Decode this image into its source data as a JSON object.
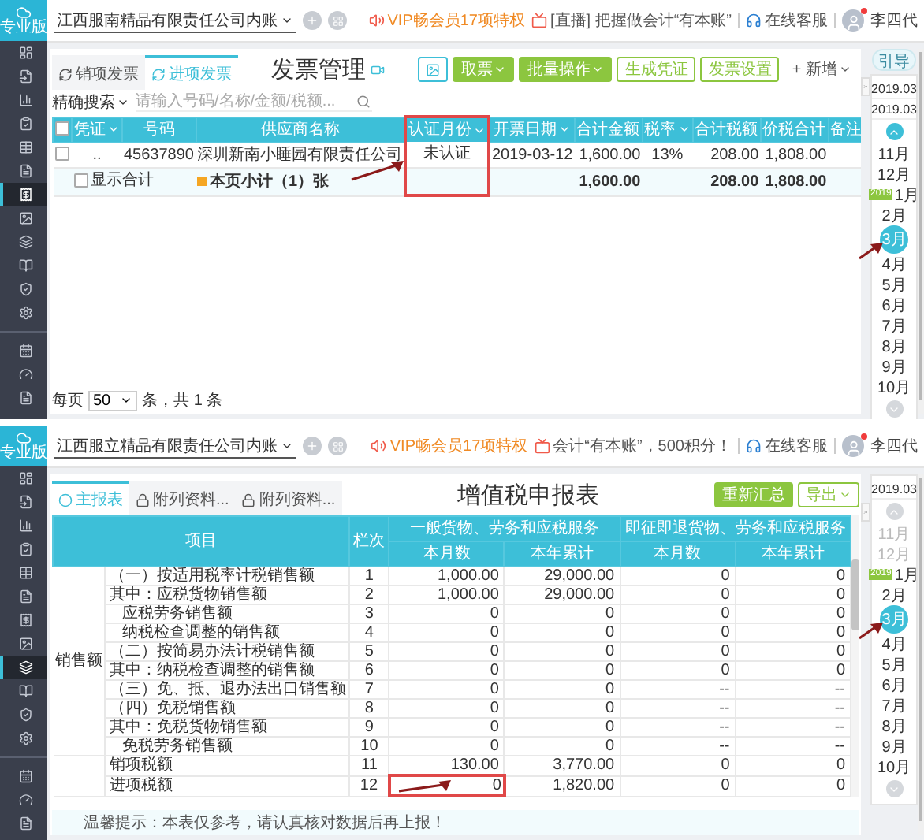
{
  "panels": [
    {
      "kind": "invoices",
      "sidebar": {
        "logo": "专业版",
        "items": [
          {
            "selected": false
          },
          {
            "selected": false
          },
          {
            "selected": false
          },
          {
            "selected": false
          },
          {
            "selected": false
          },
          {
            "selected": false
          },
          {
            "selected": true
          },
          {
            "selected": false
          },
          {
            "selected": false
          },
          {
            "selected": false
          },
          {
            "selected": false
          },
          {
            "selected": false
          }
        ],
        "bottom_items": [
          {
            "selected": false
          },
          {
            "selected": false
          },
          {
            "selected": false
          }
        ]
      },
      "topbar": {
        "company": "江西服南精品有限责任公司内账",
        "vip": "VIP畅会员17项特权",
        "live": "[直播] 把握做会计“有本账”",
        "service": "在线客服",
        "user": "李四代",
        "user_alert": true
      },
      "tabs": [
        {
          "label": "销项发票",
          "selected": false
        },
        {
          "label": "进项发票",
          "selected": true
        }
      ],
      "title": "发票管理",
      "actions": [
        {
          "kind": "icon"
        },
        {
          "kind": "solid",
          "label": "取票",
          "caret": true
        },
        {
          "kind": "solid",
          "label": "批量操作",
          "caret": true
        },
        {
          "kind": "outline",
          "label": "生成凭证",
          "caret": false
        },
        {
          "kind": "outline",
          "label": "发票设置",
          "caret": false
        },
        {
          "kind": "plain",
          "label": "+ 新增",
          "caret": true
        }
      ],
      "all_checked": false,
      "search": {
        "mode": "精确搜索",
        "placeholder": "请输入号码/名称/金额/税额..."
      },
      "columns": [
        {
          "label": "凭证",
          "sortable": true,
          "highlighted": false
        },
        {
          "label": "号码",
          "sortable": false,
          "highlighted": false
        },
        {
          "label": "供应商名称",
          "sortable": false,
          "highlighted": false
        },
        {
          "label": "认证月份",
          "sortable": true,
          "highlighted": true
        },
        {
          "label": "开票日期",
          "sortable": true,
          "highlighted": false
        },
        {
          "label": "合计金额",
          "sortable": false,
          "highlighted": false
        },
        {
          "label": "税率",
          "sortable": true,
          "highlighted": false
        },
        {
          "label": "合计税额",
          "sortable": false,
          "highlighted": false
        },
        {
          "label": "价税合计",
          "sortable": false,
          "highlighted": false
        },
        {
          "label": "备注",
          "sortable": false,
          "highlighted": false
        }
      ],
      "rows": [
        {
          "checked": false,
          "cells": [
            "..",
            "45637890",
            "深圳新南小睡园有限责任公司",
            "未认证",
            "2019-03-12",
            "1,600.00",
            "13%",
            "208.00",
            "1,808.00"
          ]
        }
      ],
      "subtotal": {
        "show_total": {
          "label": "显示合计",
          "checked": false
        },
        "label": "本页小计（1）张",
        "amount": "1,600.00",
        "tax": "208.00",
        "total": "1,808.00"
      },
      "pager": {
        "prefix": "每页",
        "size": "50",
        "suffix": "条，共 1 条"
      },
      "guide": "引导",
      "periods": {
        "dates": [
          "2019.03",
          "2019.03"
        ],
        "up_active": true,
        "months": [
          {
            "label": "11月",
            "selected": false,
            "disabled": false
          },
          {
            "label": "12月",
            "selected": false,
            "disabled": false
          },
          {
            "label": "1月",
            "selected": false,
            "disabled": false,
            "year_tag": "2019"
          },
          {
            "label": "2月",
            "selected": false,
            "disabled": false
          },
          {
            "label": "3月",
            "selected": true,
            "disabled": false
          },
          {
            "label": "4月",
            "selected": false,
            "disabled": false
          },
          {
            "label": "5月",
            "selected": false,
            "disabled": false
          },
          {
            "label": "6月",
            "selected": false,
            "disabled": false
          },
          {
            "label": "7月",
            "selected": false,
            "disabled": false
          },
          {
            "label": "8月",
            "selected": false,
            "disabled": false
          },
          {
            "label": "9月",
            "selected": false,
            "disabled": false
          },
          {
            "label": "10月",
            "selected": false,
            "disabled": false
          }
        ]
      }
    },
    {
      "kind": "tax_return",
      "sidebar": {
        "logo": "专业版",
        "items": [
          {
            "selected": false
          },
          {
            "selected": false
          },
          {
            "selected": false
          },
          {
            "selected": false
          },
          {
            "selected": false
          },
          {
            "selected": false
          },
          {
            "selected": false
          },
          {
            "selected": false
          },
          {
            "selected": true
          },
          {
            "selected": false
          },
          {
            "selected": false
          },
          {
            "selected": false
          }
        ],
        "bottom_items": [
          {
            "selected": false
          },
          {
            "selected": false
          },
          {
            "selected": false
          }
        ]
      },
      "topbar": {
        "company": "江西服立精品有限责任公司内账",
        "vip": "VIP畅会员17项特权",
        "live": "会计“有本账”，500积分！",
        "service": "在线客服",
        "user": "李四代",
        "user_alert": true
      },
      "tabs": [
        {
          "label": "主报表",
          "selected": true
        },
        {
          "label": "附列资料...",
          "selected": false
        },
        {
          "label": "附列资料...",
          "selected": false
        }
      ],
      "title": "增值税申报表",
      "actions": [
        {
          "kind": "solid",
          "label": "重新汇总",
          "caret": false
        },
        {
          "kind": "outline",
          "label": "导出",
          "caret": true
        }
      ],
      "header": {
        "item": "项目",
        "line": "栏次",
        "groups": [
          {
            "label": "一般货物、劳务和应税服务",
            "columns": [
              "本月数",
              "本年累计"
            ]
          },
          {
            "label": "即征即退货物、劳务和应税服务",
            "columns": [
              "本月数",
              "本年累计"
            ]
          }
        ]
      },
      "row_groups": [
        {
          "label": "销售额",
          "rows": [
            {
              "item": "（一）按适用税率计税销售额",
              "indent": false,
              "line": "1",
              "values": [
                "1,000.00",
                "29,000.00",
                "0",
                "0"
              ],
              "marked": false
            },
            {
              "item": "其中：应税货物销售额",
              "indent": false,
              "line": "2",
              "values": [
                "1,000.00",
                "29,000.00",
                "0",
                "0"
              ],
              "marked": false
            },
            {
              "item": "应税劳务销售额",
              "indent": true,
              "line": "3",
              "values": [
                "0",
                "0",
                "0",
                "0"
              ],
              "marked": false
            },
            {
              "item": "纳税检查调整的销售额",
              "indent": true,
              "line": "4",
              "values": [
                "0",
                "0",
                "0",
                "0"
              ],
              "marked": false
            },
            {
              "item": "（二）按简易办法计税销售额",
              "indent": false,
              "line": "5",
              "values": [
                "0",
                "0",
                "0",
                "0"
              ],
              "marked": false
            },
            {
              "item": "其中：纳税检查调整的销售额",
              "indent": false,
              "line": "6",
              "values": [
                "0",
                "0",
                "0",
                "0"
              ],
              "marked": false
            },
            {
              "item": "（三）免、抵、退办法出口销售额",
              "indent": false,
              "line": "7",
              "values": [
                "0",
                "0",
                "--",
                "--"
              ],
              "marked": false
            },
            {
              "item": "（四）免税销售额",
              "indent": false,
              "line": "8",
              "values": [
                "0",
                "0",
                "--",
                "--"
              ],
              "marked": false
            },
            {
              "item": "其中：免税货物销售额",
              "indent": false,
              "line": "9",
              "values": [
                "0",
                "0",
                "--",
                "--"
              ],
              "marked": false
            },
            {
              "item": "免税劳务销售额",
              "indent": true,
              "line": "10",
              "values": [
                "0",
                "0",
                "--",
                "--"
              ],
              "marked": false
            }
          ]
        },
        {
          "rows": [
            {
              "item": "销项税额",
              "indent": false,
              "line": "11",
              "values": [
                "130.00",
                "3,770.00",
                "0",
                "0"
              ],
              "marked": false
            },
            {
              "item": "进项税额",
              "indent": false,
              "line": "12",
              "values": [
                "0",
                "1,820.00",
                "0",
                "0"
              ],
              "marked": true
            }
          ]
        }
      ],
      "tip": "温馨提示：本表仅参考，请认真核对数据后再上报！",
      "periods": {
        "dates": [
          "2019.03"
        ],
        "up_active": false,
        "months": [
          {
            "label": "11月",
            "selected": false,
            "disabled": true
          },
          {
            "label": "12月",
            "selected": false,
            "disabled": true
          },
          {
            "label": "1月",
            "selected": false,
            "disabled": false,
            "year_tag": "2019"
          },
          {
            "label": "2月",
            "selected": false,
            "disabled": false
          },
          {
            "label": "3月",
            "selected": true,
            "disabled": false
          },
          {
            "label": "4月",
            "selected": false,
            "disabled": false
          },
          {
            "label": "5月",
            "selected": false,
            "disabled": false
          },
          {
            "label": "6月",
            "selected": false,
            "disabled": false
          },
          {
            "label": "7月",
            "selected": false,
            "disabled": false
          },
          {
            "label": "8月",
            "selected": false,
            "disabled": false
          },
          {
            "label": "9月",
            "selected": false,
            "disabled": false
          },
          {
            "label": "10月",
            "selected": false,
            "disabled": false
          }
        ]
      }
    }
  ]
}
